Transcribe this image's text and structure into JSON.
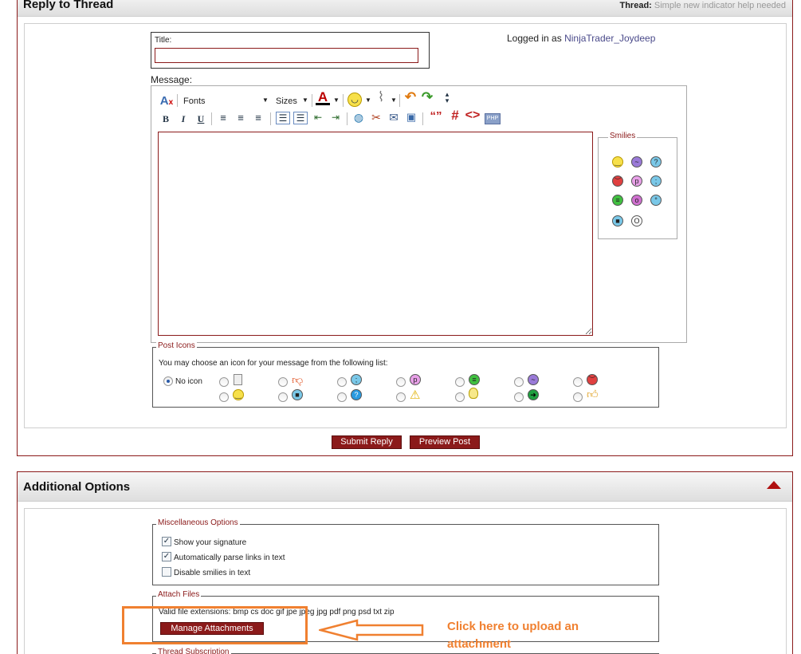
{
  "reply_panel": {
    "title": "Reply to Thread",
    "thread_label": "Thread:",
    "thread_name": "Simple new indicator help needed"
  },
  "form": {
    "title_label": "Title:",
    "title_value": "",
    "logged_in_prefix": "Logged in as",
    "username": "NinjaTrader_Joydeep",
    "message_label": "Message:"
  },
  "toolbar": {
    "fonts_label": "Fonts",
    "sizes_label": "Sizes",
    "font_color_glyph": "A",
    "bold": "B",
    "italic": "I",
    "underline": "U",
    "hash_glyph": "#",
    "code_glyph": "<>",
    "quote_glyph": "“”",
    "php_glyph": "PHP"
  },
  "smilies": {
    "legend": "Smilies",
    "items": [
      "smile",
      "confused",
      "question",
      "mad",
      "tongue",
      "wink",
      "grin",
      "cool-eyes",
      "rolleyes",
      "cool",
      "eek"
    ]
  },
  "post_icons": {
    "legend": "Post Icons",
    "hint": "You may choose an icon for your message from the following list:",
    "no_icon_label": "No icon",
    "selected": "No icon"
  },
  "buttons": {
    "submit": "Submit Reply",
    "preview": "Preview Post",
    "manage_attachments": "Manage Attachments"
  },
  "additional": {
    "title": "Additional Options",
    "misc_legend": "Miscellaneous Options",
    "options": [
      {
        "label": "Show your signature",
        "checked": true
      },
      {
        "label": "Automatically parse links in text",
        "checked": true
      },
      {
        "label": "Disable smilies in text",
        "checked": false
      }
    ],
    "attach_legend": "Attach Files",
    "valid_ext": "Valid file extensions: bmp cs doc gif jpe jpeg jpg pdf png psd txt zip",
    "subscription_legend": "Thread Subscription"
  },
  "annotation": {
    "callout": "Click here to upload an attachment",
    "color": "#f08030"
  },
  "colors": {
    "brand": "#8b1a1a",
    "username": "#4a4a8a"
  }
}
